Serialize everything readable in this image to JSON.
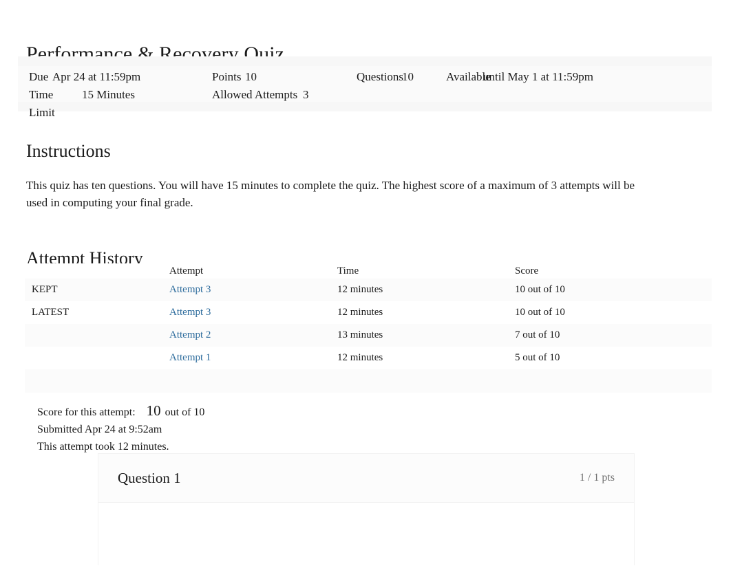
{
  "quiz": {
    "title": "Performance & Recovery Quiz",
    "details": {
      "due_label": "Due",
      "due_value": "Apr 24 at 11:59pm",
      "points_label": "Points",
      "points_value": "10",
      "questions_label": "Questions",
      "questions_value": "10",
      "available_label": "Available",
      "available_value": "until May 1 at 11:59pm",
      "time_limit_label": "Time Limit",
      "time_limit_value": "15 Minutes",
      "allowed_attempts_label": "Allowed Attempts",
      "allowed_attempts_value": "3"
    }
  },
  "instructions": {
    "heading": "Instructions",
    "body": "This quiz has ten questions. You will have 15 minutes to complete the quiz. The highest score of a maximum of 3 attempts will be used in computing your final grade."
  },
  "attempt_history": {
    "heading": "Attempt History",
    "columns": {
      "flag": "",
      "attempt": "Attempt",
      "time": "Time",
      "score": "Score"
    },
    "rows": [
      {
        "flag": "KEPT",
        "attempt": "Attempt 3",
        "time": "12 minutes",
        "score": "10 out of 10"
      },
      {
        "flag": "LATEST",
        "attempt": "Attempt 3",
        "time": "12 minutes",
        "score": "10 out of 10"
      },
      {
        "flag": "",
        "attempt": "Attempt 2",
        "time": "13 minutes",
        "score": "7 out of 10"
      },
      {
        "flag": "",
        "attempt": "Attempt 1",
        "time": "12 minutes",
        "score": "5 out of 10"
      }
    ]
  },
  "score_summary": {
    "score_label": "Score for this attempt:",
    "score_value": "10",
    "score_out_of": "out of 10",
    "submitted": "Submitted Apr 24 at 9:52am",
    "duration": "This attempt took 12 minutes."
  },
  "question": {
    "name": "Question 1",
    "points": "1 / 1 pts"
  },
  "colors": {
    "link": "#2c6b9c",
    "text": "#1a1a1a",
    "muted": "#717171",
    "band": "#fafafa"
  }
}
